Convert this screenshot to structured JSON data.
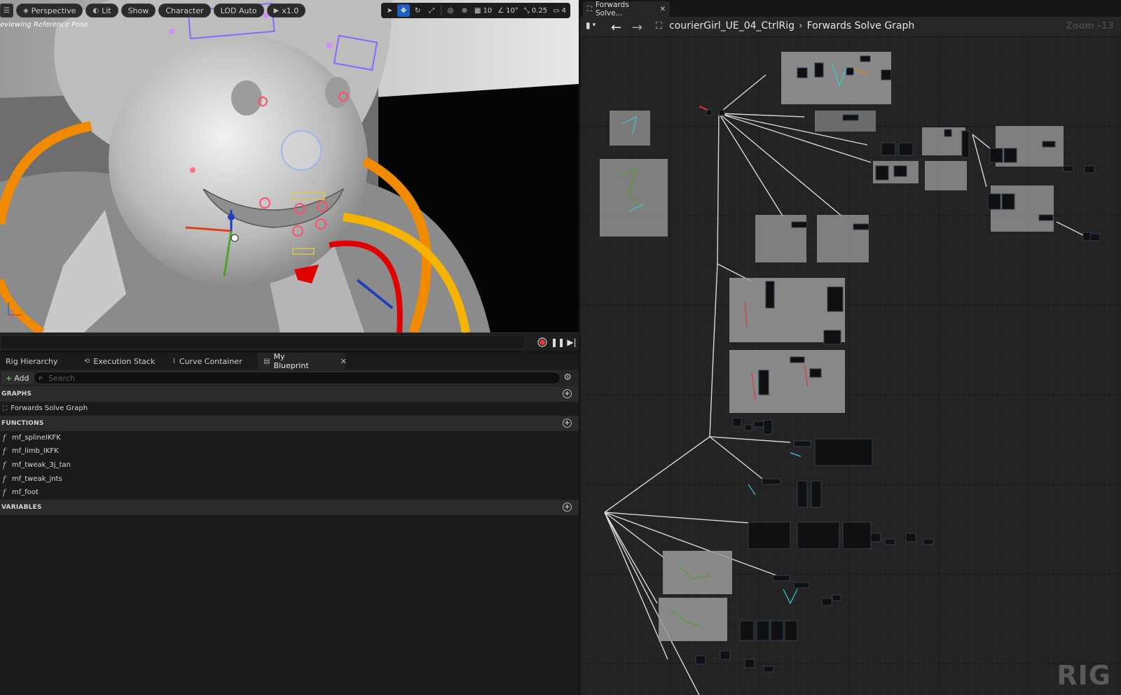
{
  "viewport": {
    "toolbar": {
      "menu_icon": "hamburger-icon",
      "perspective": "Perspective",
      "lit": "Lit",
      "show": "Show",
      "character": "Character",
      "lod": "LOD Auto",
      "speed": "x1.0",
      "grid_snap": "10",
      "rotation_snap": "10°",
      "scale_snap": "0.25",
      "camera_speed": "4"
    },
    "status_text": "eviewing Reference Pose"
  },
  "playback": {
    "record_icon": "record-icon",
    "pause_icon": "pause-icon",
    "step_icon": "step-forward-icon"
  },
  "bottom_tabs": [
    "Rig Hierarchy",
    "Execution Stack",
    "Curve Container",
    "My Blueprint"
  ],
  "my_blueprint": {
    "add_label": "Add",
    "search_placeholder": "Search",
    "sections": {
      "graphs": {
        "title": "GRAPHS",
        "items": [
          "Forwards Solve Graph"
        ]
      },
      "functions": {
        "title": "FUNCTIONS",
        "items": [
          "mf_splineIKFK",
          "mf_limb_IKFK",
          "mf_tweak_3j_tan",
          "mf_tweak_jnts",
          "mf_foot"
        ]
      },
      "variables": {
        "title": "VARIABLES",
        "items": []
      }
    }
  },
  "graph_editor": {
    "tab_label": "Forwards Solve...",
    "breadcrumb": [
      "courierGirl_UE_04_CtrlRig",
      "Forwards Solve Graph"
    ],
    "zoom": "Zoom -13",
    "watermark": "RIG"
  },
  "colors": {
    "accent_blue": "#1f5fbf",
    "record_red": "#d93a3a",
    "add_green": "#6cc04a"
  }
}
